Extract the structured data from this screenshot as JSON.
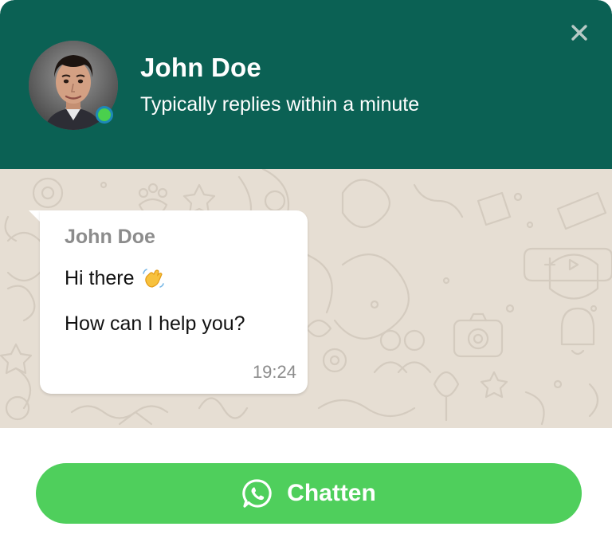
{
  "header": {
    "name": "John Doe",
    "subtitle": "Typically replies within a minute",
    "online": true,
    "background_color": "#0b6154",
    "status_color": "#4ad04d"
  },
  "message": {
    "sender": "John Doe",
    "line1": "Hi there",
    "emoji": "waving-hand-icon",
    "line2": "How can I help you?",
    "time": "19:24"
  },
  "icons": {
    "close": "close-icon",
    "whatsapp": "whatsapp-icon"
  },
  "cta": {
    "label": "Chatten",
    "color": "#4fcf5c"
  }
}
